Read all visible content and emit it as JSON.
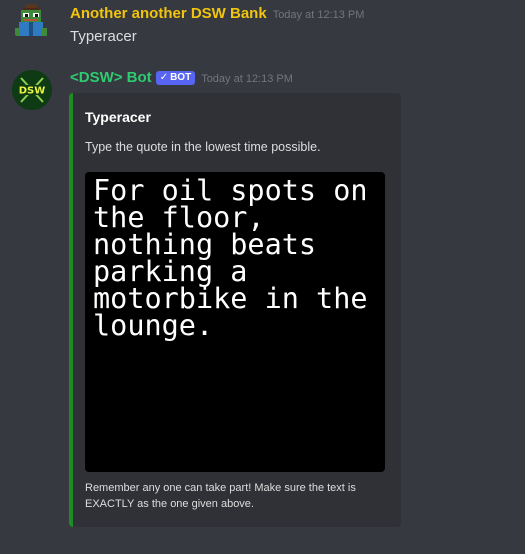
{
  "messages": [
    {
      "author": "Another another DSW Bank",
      "timestamp": "Today at 12:13 PM",
      "content": "Typeracer",
      "avatar_icon": "pixel-frog-avatar-icon"
    },
    {
      "author": "<DSW> Bot",
      "bot_tag": "BOT",
      "verified_icon": "✓",
      "timestamp": "Today at 12:13 PM",
      "avatar_icon": "dsw-logo-avatar-icon",
      "avatar_text": "DSW",
      "embed": {
        "accent_color": "#1f8b24",
        "title": "Typeracer",
        "description": "Type the quote in the lowest time possible.",
        "quote_lines": "For oil spots on\nthe floor,\nnothing beats\nparking a\nmotorbike in the\nlounge.",
        "footer": "Remember any one can take part! Make sure the text is EXACTLY as the one given above."
      }
    }
  ],
  "colors": {
    "background": "#36393f",
    "embed_background": "#2f3136",
    "author1": "#f1c40f",
    "author2": "#2ecc71",
    "bot_tag": "#5865f2"
  }
}
